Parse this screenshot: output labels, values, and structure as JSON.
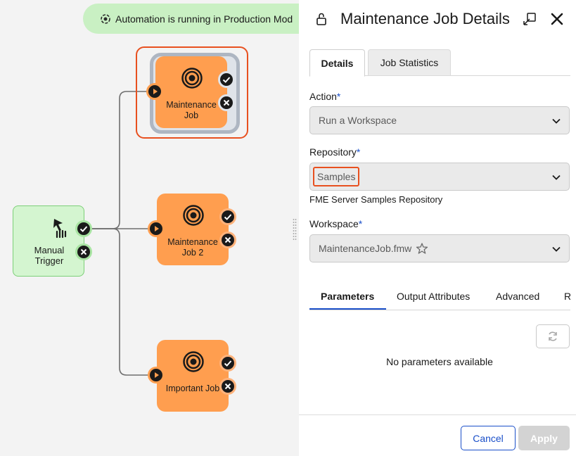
{
  "canvas": {
    "banner_text": "Automation is running in Production Mod",
    "trigger": {
      "label": "Manual Trigger",
      "icon": "hand-pointer-icon"
    },
    "jobs": [
      {
        "label": "Maintenance Job",
        "icon": "target-icon",
        "selected": true
      },
      {
        "label": "Maintenance Job 2",
        "icon": "target-icon",
        "selected": false
      },
      {
        "label": "Important Job",
        "icon": "target-icon",
        "selected": false
      }
    ]
  },
  "panel": {
    "title": "Maintenance Job Details",
    "tabs": [
      {
        "label": "Details",
        "active": true
      },
      {
        "label": "Job Statistics",
        "active": false
      }
    ],
    "action": {
      "label": "Action",
      "value": "Run a Workspace"
    },
    "repository": {
      "label": "Repository",
      "value": "Samples",
      "help": "FME Server Samples Repository"
    },
    "workspace": {
      "label": "Workspace",
      "value": "MaintenanceJob.fmw"
    },
    "required_mark": "*",
    "subtabs": [
      {
        "label": "Parameters",
        "active": true
      },
      {
        "label": "Output Attributes",
        "active": false
      },
      {
        "label": "Advanced",
        "active": false
      },
      {
        "label": "R",
        "active": false
      }
    ],
    "empty_message": "No parameters available",
    "cancel_label": "Cancel",
    "apply_label": "Apply"
  },
  "colors": {
    "job_orange": "#ff9e4f",
    "selection_outline": "#e8501f",
    "trigger_green": "#d4f5d0",
    "banner_green": "#c9f0c3",
    "accent_blue": "#1a4fc9"
  }
}
